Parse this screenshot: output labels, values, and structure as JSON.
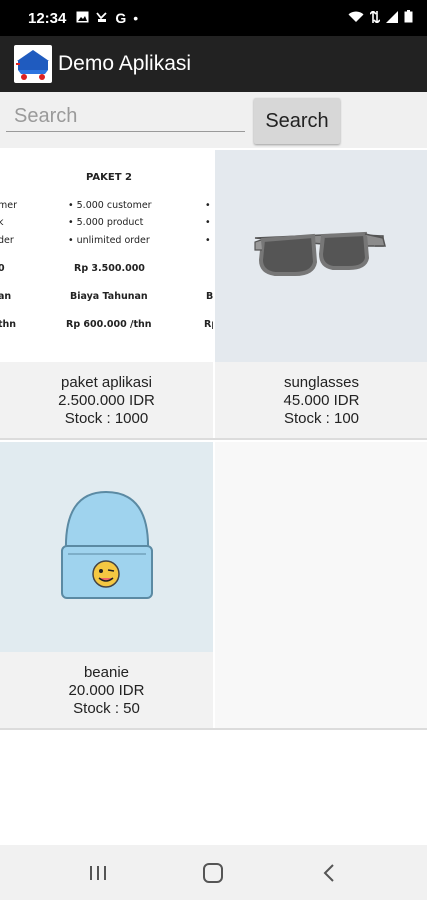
{
  "status_bar": {
    "time": "12:34",
    "left_icons": [
      "image-icon",
      "missed-call-icon",
      "google-g-icon",
      "dot-icon"
    ],
    "right_icons": [
      "wifi-icon",
      "data-icon",
      "signal-icon",
      "battery-icon"
    ]
  },
  "app_bar": {
    "title": "Demo Aplikasi",
    "logo": "shopping-cart-logo-icon"
  },
  "search": {
    "placeholder": "Search",
    "button_label": "Search"
  },
  "products": [
    {
      "name": "paket aplikasi",
      "price": "2.500.000 IDR",
      "stock": "Stock : 1000",
      "image": {
        "heading": "PAKET 2",
        "left_lines": [
          "mer",
          "k",
          "der"
        ],
        "bullets": [
          "5.000 customer",
          "5.000 product",
          "unlimited order"
        ],
        "price": "Rp 3.500.000",
        "left_price": "0",
        "left_annual": "an",
        "annual_label": "Biaya Tahunan",
        "right_annual": "B",
        "left_fee": "thn",
        "annual_fee": "Rp 600.000 /thn",
        "right_fee": "Rp"
      }
    },
    {
      "name": "sunglasses",
      "price": "45.000 IDR",
      "stock": "Stock : 100"
    },
    {
      "name": "beanie",
      "price": "20.000 IDR",
      "stock": "Stock : 50"
    }
  ],
  "nav_bar": [
    "recent-apps-icon",
    "home-icon",
    "back-icon"
  ]
}
